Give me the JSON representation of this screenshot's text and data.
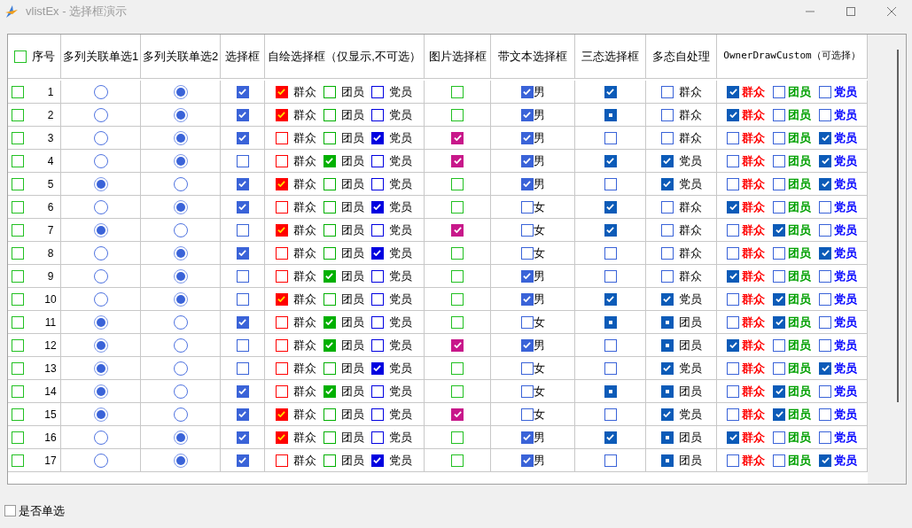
{
  "window": {
    "title": "vlistEx - 选择框演示"
  },
  "table": {
    "header_checked": false,
    "columns": [
      "序号",
      "多列关联单选1",
      "多列关联单选2",
      "选择框",
      "自绘选择框（仅显示,不可选）",
      "图片选择框",
      "带文本选择框",
      "三态选择框",
      "多态自处理",
      "OwnerDrawCustom（可选择）"
    ],
    "rows": [
      {
        "no": "1",
        "checked": false,
        "radio1": false,
        "radio2": true,
        "check": true,
        "self": [
          {
            "label": "群众",
            "color": "#ff0000",
            "checked": true
          },
          {
            "label": "团员",
            "color": "#00b000",
            "checked": false
          },
          {
            "label": "党员",
            "color": "#0000e0",
            "checked": false
          }
        ],
        "picture_checked": false,
        "gender": {
          "label": "男",
          "checked": true
        },
        "tristate": {
          "checked": true,
          "mixed": false
        },
        "multistate": {
          "checked": false,
          "mixed": false,
          "label": "群众"
        },
        "owner": [
          {
            "label": "群众",
            "color": "#ff0000",
            "checked": true
          },
          {
            "label": "团员",
            "color": "#00a000",
            "checked": false
          },
          {
            "label": "党员",
            "color": "#0000ff",
            "checked": false
          }
        ]
      },
      {
        "no": "2",
        "checked": false,
        "radio1": false,
        "radio2": true,
        "check": true,
        "self": [
          {
            "label": "群众",
            "color": "#ff0000",
            "checked": true
          },
          {
            "label": "团员",
            "color": "#00b000",
            "checked": false
          },
          {
            "label": "党员",
            "color": "#0000e0",
            "checked": false
          }
        ],
        "picture_checked": false,
        "gender": {
          "label": "男",
          "checked": true
        },
        "tristate": {
          "checked": true,
          "mixed": true
        },
        "multistate": {
          "checked": false,
          "mixed": false,
          "label": "群众"
        },
        "owner": [
          {
            "label": "群众",
            "color": "#ff0000",
            "checked": true
          },
          {
            "label": "团员",
            "color": "#00a000",
            "checked": false
          },
          {
            "label": "党员",
            "color": "#0000ff",
            "checked": false
          }
        ]
      },
      {
        "no": "3",
        "checked": false,
        "radio1": false,
        "radio2": true,
        "check": true,
        "self": [
          {
            "label": "群众",
            "color": "#ff0000",
            "checked": false
          },
          {
            "label": "团员",
            "color": "#00b000",
            "checked": false
          },
          {
            "label": "党员",
            "color": "#0000e0",
            "checked": true
          }
        ],
        "picture_checked": true,
        "gender": {
          "label": "男",
          "checked": true
        },
        "tristate": {
          "checked": false,
          "mixed": false
        },
        "multistate": {
          "checked": false,
          "mixed": false,
          "label": "群众"
        },
        "owner": [
          {
            "label": "群众",
            "color": "#ff0000",
            "checked": false
          },
          {
            "label": "团员",
            "color": "#00a000",
            "checked": false
          },
          {
            "label": "党员",
            "color": "#0000ff",
            "checked": true
          }
        ]
      },
      {
        "no": "4",
        "checked": false,
        "radio1": false,
        "radio2": true,
        "check": false,
        "self": [
          {
            "label": "群众",
            "color": "#ff0000",
            "checked": false
          },
          {
            "label": "团员",
            "color": "#00b000",
            "checked": true
          },
          {
            "label": "党员",
            "color": "#0000e0",
            "checked": false
          }
        ],
        "picture_checked": true,
        "gender": {
          "label": "男",
          "checked": true
        },
        "tristate": {
          "checked": true,
          "mixed": false
        },
        "multistate": {
          "checked": true,
          "mixed": false,
          "label": "党员"
        },
        "owner": [
          {
            "label": "群众",
            "color": "#ff0000",
            "checked": false
          },
          {
            "label": "团员",
            "color": "#00a000",
            "checked": false
          },
          {
            "label": "党员",
            "color": "#0000ff",
            "checked": true
          }
        ]
      },
      {
        "no": "5",
        "checked": false,
        "radio1": true,
        "radio2": false,
        "check": true,
        "self": [
          {
            "label": "群众",
            "color": "#ff0000",
            "checked": true
          },
          {
            "label": "团员",
            "color": "#00b000",
            "checked": false
          },
          {
            "label": "党员",
            "color": "#0000e0",
            "checked": false
          }
        ],
        "picture_checked": false,
        "gender": {
          "label": "男",
          "checked": true
        },
        "tristate": {
          "checked": false,
          "mixed": false
        },
        "multistate": {
          "checked": true,
          "mixed": false,
          "label": "党员"
        },
        "owner": [
          {
            "label": "群众",
            "color": "#ff0000",
            "checked": false
          },
          {
            "label": "团员",
            "color": "#00a000",
            "checked": false
          },
          {
            "label": "党员",
            "color": "#0000ff",
            "checked": true
          }
        ]
      },
      {
        "no": "6",
        "checked": false,
        "radio1": false,
        "radio2": true,
        "check": true,
        "self": [
          {
            "label": "群众",
            "color": "#ff0000",
            "checked": false
          },
          {
            "label": "团员",
            "color": "#00b000",
            "checked": false
          },
          {
            "label": "党员",
            "color": "#0000e0",
            "checked": true
          }
        ],
        "picture_checked": false,
        "gender": {
          "label": "女",
          "checked": false
        },
        "tristate": {
          "checked": true,
          "mixed": false
        },
        "multistate": {
          "checked": false,
          "mixed": false,
          "label": "群众"
        },
        "owner": [
          {
            "label": "群众",
            "color": "#ff0000",
            "checked": true
          },
          {
            "label": "团员",
            "color": "#00a000",
            "checked": false
          },
          {
            "label": "党员",
            "color": "#0000ff",
            "checked": false
          }
        ]
      },
      {
        "no": "7",
        "checked": false,
        "radio1": true,
        "radio2": false,
        "check": false,
        "self": [
          {
            "label": "群众",
            "color": "#ff0000",
            "checked": true
          },
          {
            "label": "团员",
            "color": "#00b000",
            "checked": false
          },
          {
            "label": "党员",
            "color": "#0000e0",
            "checked": false
          }
        ],
        "picture_checked": true,
        "gender": {
          "label": "女",
          "checked": false
        },
        "tristate": {
          "checked": true,
          "mixed": false
        },
        "multistate": {
          "checked": false,
          "mixed": false,
          "label": "群众"
        },
        "owner": [
          {
            "label": "群众",
            "color": "#ff0000",
            "checked": false
          },
          {
            "label": "团员",
            "color": "#00a000",
            "checked": true
          },
          {
            "label": "党员",
            "color": "#0000ff",
            "checked": false
          }
        ]
      },
      {
        "no": "8",
        "checked": false,
        "radio1": false,
        "radio2": true,
        "check": true,
        "self": [
          {
            "label": "群众",
            "color": "#ff0000",
            "checked": false
          },
          {
            "label": "团员",
            "color": "#00b000",
            "checked": false
          },
          {
            "label": "党员",
            "color": "#0000e0",
            "checked": true
          }
        ],
        "picture_checked": false,
        "gender": {
          "label": "女",
          "checked": false
        },
        "tristate": {
          "checked": false,
          "mixed": false
        },
        "multistate": {
          "checked": false,
          "mixed": false,
          "label": "群众"
        },
        "owner": [
          {
            "label": "群众",
            "color": "#ff0000",
            "checked": false
          },
          {
            "label": "团员",
            "color": "#00a000",
            "checked": false
          },
          {
            "label": "党员",
            "color": "#0000ff",
            "checked": true
          }
        ]
      },
      {
        "no": "9",
        "checked": false,
        "radio1": false,
        "radio2": true,
        "check": false,
        "self": [
          {
            "label": "群众",
            "color": "#ff0000",
            "checked": false
          },
          {
            "label": "团员",
            "color": "#00b000",
            "checked": true
          },
          {
            "label": "党员",
            "color": "#0000e0",
            "checked": false
          }
        ],
        "picture_checked": false,
        "gender": {
          "label": "男",
          "checked": true
        },
        "tristate": {
          "checked": false,
          "mixed": false
        },
        "multistate": {
          "checked": false,
          "mixed": false,
          "label": "群众"
        },
        "owner": [
          {
            "label": "群众",
            "color": "#ff0000",
            "checked": true
          },
          {
            "label": "团员",
            "color": "#00a000",
            "checked": false
          },
          {
            "label": "党员",
            "color": "#0000ff",
            "checked": false
          }
        ]
      },
      {
        "no": "10",
        "checked": false,
        "radio1": false,
        "radio2": true,
        "check": false,
        "self": [
          {
            "label": "群众",
            "color": "#ff0000",
            "checked": true
          },
          {
            "label": "团员",
            "color": "#00b000",
            "checked": false
          },
          {
            "label": "党员",
            "color": "#0000e0",
            "checked": false
          }
        ],
        "picture_checked": false,
        "gender": {
          "label": "男",
          "checked": true
        },
        "tristate": {
          "checked": true,
          "mixed": false
        },
        "multistate": {
          "checked": true,
          "mixed": false,
          "label": "党员"
        },
        "owner": [
          {
            "label": "群众",
            "color": "#ff0000",
            "checked": false
          },
          {
            "label": "团员",
            "color": "#00a000",
            "checked": true
          },
          {
            "label": "党员",
            "color": "#0000ff",
            "checked": false
          }
        ]
      },
      {
        "no": "11",
        "checked": false,
        "radio1": true,
        "radio2": false,
        "check": true,
        "self": [
          {
            "label": "群众",
            "color": "#ff0000",
            "checked": false
          },
          {
            "label": "团员",
            "color": "#00b000",
            "checked": true
          },
          {
            "label": "党员",
            "color": "#0000e0",
            "checked": false
          }
        ],
        "picture_checked": false,
        "gender": {
          "label": "女",
          "checked": false
        },
        "tristate": {
          "checked": true,
          "mixed": true
        },
        "multistate": {
          "checked": true,
          "mixed": true,
          "label": "团员"
        },
        "owner": [
          {
            "label": "群众",
            "color": "#ff0000",
            "checked": false
          },
          {
            "label": "团员",
            "color": "#00a000",
            "checked": true
          },
          {
            "label": "党员",
            "color": "#0000ff",
            "checked": false
          }
        ]
      },
      {
        "no": "12",
        "checked": false,
        "radio1": true,
        "radio2": false,
        "check": false,
        "self": [
          {
            "label": "群众",
            "color": "#ff0000",
            "checked": false
          },
          {
            "label": "团员",
            "color": "#00b000",
            "checked": true
          },
          {
            "label": "党员",
            "color": "#0000e0",
            "checked": false
          }
        ],
        "picture_checked": true,
        "gender": {
          "label": "男",
          "checked": true
        },
        "tristate": {
          "checked": false,
          "mixed": false
        },
        "multistate": {
          "checked": true,
          "mixed": true,
          "label": "团员"
        },
        "owner": [
          {
            "label": "群众",
            "color": "#ff0000",
            "checked": true
          },
          {
            "label": "团员",
            "color": "#00a000",
            "checked": false
          },
          {
            "label": "党员",
            "color": "#0000ff",
            "checked": false
          }
        ]
      },
      {
        "no": "13",
        "checked": false,
        "radio1": true,
        "radio2": false,
        "check": false,
        "self": [
          {
            "label": "群众",
            "color": "#ff0000",
            "checked": false
          },
          {
            "label": "团员",
            "color": "#00b000",
            "checked": false
          },
          {
            "label": "党员",
            "color": "#0000e0",
            "checked": true
          }
        ],
        "picture_checked": false,
        "gender": {
          "label": "女",
          "checked": false
        },
        "tristate": {
          "checked": false,
          "mixed": false
        },
        "multistate": {
          "checked": true,
          "mixed": false,
          "label": "党员"
        },
        "owner": [
          {
            "label": "群众",
            "color": "#ff0000",
            "checked": false
          },
          {
            "label": "团员",
            "color": "#00a000",
            "checked": false
          },
          {
            "label": "党员",
            "color": "#0000ff",
            "checked": true
          }
        ]
      },
      {
        "no": "14",
        "checked": false,
        "radio1": true,
        "radio2": false,
        "check": true,
        "self": [
          {
            "label": "群众",
            "color": "#ff0000",
            "checked": false
          },
          {
            "label": "团员",
            "color": "#00b000",
            "checked": true
          },
          {
            "label": "党员",
            "color": "#0000e0",
            "checked": false
          }
        ],
        "picture_checked": false,
        "gender": {
          "label": "女",
          "checked": false
        },
        "tristate": {
          "checked": true,
          "mixed": true
        },
        "multistate": {
          "checked": true,
          "mixed": true,
          "label": "团员"
        },
        "owner": [
          {
            "label": "群众",
            "color": "#ff0000",
            "checked": false
          },
          {
            "label": "团员",
            "color": "#00a000",
            "checked": true
          },
          {
            "label": "党员",
            "color": "#0000ff",
            "checked": false
          }
        ]
      },
      {
        "no": "15",
        "checked": false,
        "radio1": true,
        "radio2": false,
        "check": true,
        "self": [
          {
            "label": "群众",
            "color": "#ff0000",
            "checked": true
          },
          {
            "label": "团员",
            "color": "#00b000",
            "checked": false
          },
          {
            "label": "党员",
            "color": "#0000e0",
            "checked": false
          }
        ],
        "picture_checked": true,
        "gender": {
          "label": "女",
          "checked": false
        },
        "tristate": {
          "checked": false,
          "mixed": false
        },
        "multistate": {
          "checked": true,
          "mixed": false,
          "label": "党员"
        },
        "owner": [
          {
            "label": "群众",
            "color": "#ff0000",
            "checked": false
          },
          {
            "label": "团员",
            "color": "#00a000",
            "checked": true
          },
          {
            "label": "党员",
            "color": "#0000ff",
            "checked": false
          }
        ]
      },
      {
        "no": "16",
        "checked": false,
        "radio1": false,
        "radio2": true,
        "check": true,
        "self": [
          {
            "label": "群众",
            "color": "#ff0000",
            "checked": true
          },
          {
            "label": "团员",
            "color": "#00b000",
            "checked": false
          },
          {
            "label": "党员",
            "color": "#0000e0",
            "checked": false
          }
        ],
        "picture_checked": false,
        "gender": {
          "label": "男",
          "checked": true
        },
        "tristate": {
          "checked": true,
          "mixed": false
        },
        "multistate": {
          "checked": true,
          "mixed": true,
          "label": "团员"
        },
        "owner": [
          {
            "label": "群众",
            "color": "#ff0000",
            "checked": true
          },
          {
            "label": "团员",
            "color": "#00a000",
            "checked": false
          },
          {
            "label": "党员",
            "color": "#0000ff",
            "checked": false
          }
        ]
      },
      {
        "no": "17",
        "checked": false,
        "radio1": false,
        "radio2": true,
        "check": true,
        "self": [
          {
            "label": "群众",
            "color": "#ff0000",
            "checked": false
          },
          {
            "label": "团员",
            "color": "#00b000",
            "checked": false
          },
          {
            "label": "党员",
            "color": "#0000e0",
            "checked": true
          }
        ],
        "picture_checked": false,
        "gender": {
          "label": "男",
          "checked": true
        },
        "tristate": {
          "checked": false,
          "mixed": false
        },
        "multistate": {
          "checked": true,
          "mixed": true,
          "label": "团员"
        },
        "owner": [
          {
            "label": "群众",
            "color": "#ff0000",
            "checked": false
          },
          {
            "label": "团员",
            "color": "#00a000",
            "checked": false
          },
          {
            "label": "党员",
            "color": "#0000ff",
            "checked": true
          }
        ]
      }
    ]
  },
  "single_select": {
    "label": "是否单选",
    "checked": false
  }
}
